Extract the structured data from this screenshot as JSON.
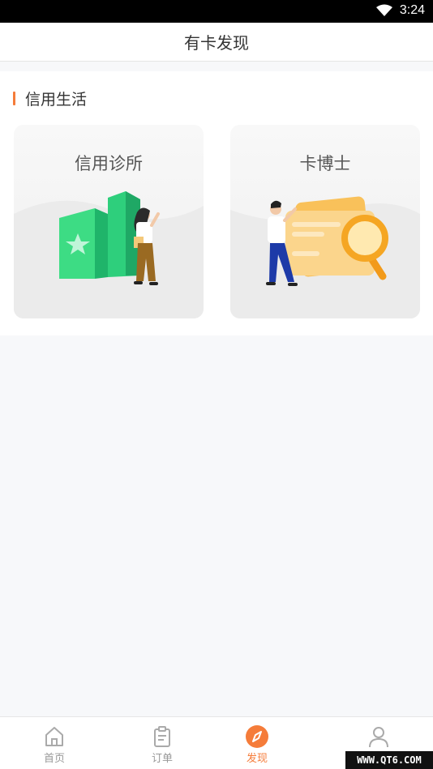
{
  "status_bar": {
    "time": "3:24",
    "icons": [
      "wifi-icon"
    ]
  },
  "header": {
    "title": "有卡发现"
  },
  "section": {
    "label": "信用生活",
    "accent_color": "#f57c3a",
    "cards": [
      {
        "title": "信用诊所",
        "illustration": "credit-clinic-illustration"
      },
      {
        "title": "卡博士",
        "illustration": "card-doctor-illustration"
      }
    ]
  },
  "bottom_nav": {
    "items": [
      {
        "label": "首页",
        "icon": "home-icon",
        "active": false
      },
      {
        "label": "订单",
        "icon": "clipboard-icon",
        "active": false
      },
      {
        "label": "发现",
        "icon": "compass-icon",
        "active": true
      },
      {
        "label": "",
        "icon": "user-icon",
        "active": false
      }
    ]
  },
  "watermark": "WWW.QT6.COM"
}
